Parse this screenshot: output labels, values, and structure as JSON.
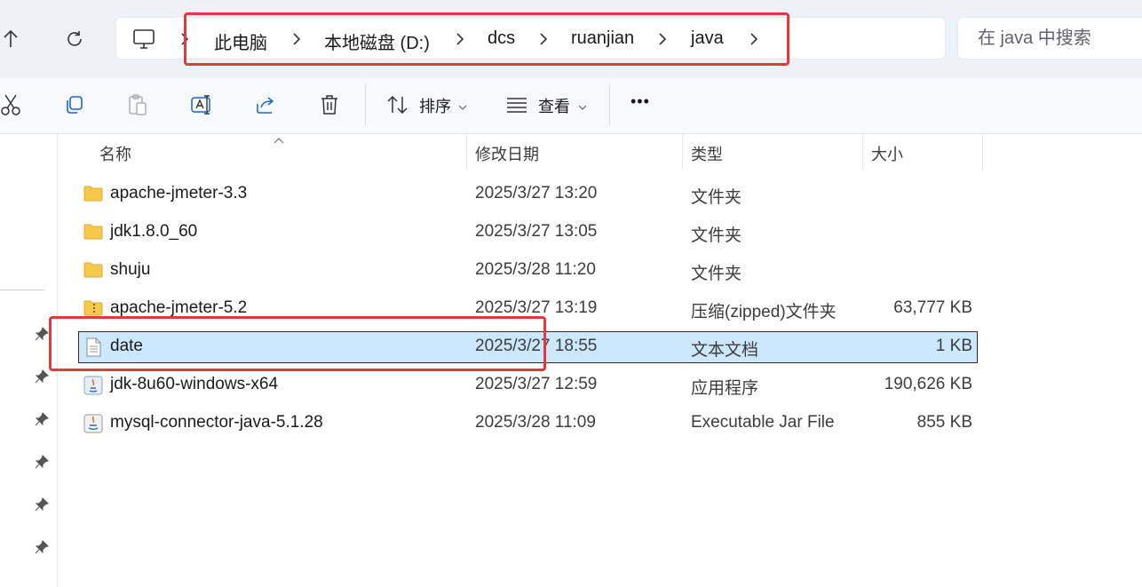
{
  "address_bar": {
    "crumbs": [
      "此电脑",
      "本地磁盘 (D:)",
      "dcs",
      "ruanjian",
      "java"
    ]
  },
  "search": {
    "placeholder": "在 java 中搜索"
  },
  "toolbar": {
    "sort_label": "排序",
    "view_label": "查看",
    "more_label": "•••"
  },
  "columns": {
    "name": "名称",
    "date": "修改日期",
    "type": "类型",
    "size": "大小"
  },
  "files": [
    {
      "name": "apache-jmeter-3.3",
      "date": "2025/3/27 13:20",
      "type": "文件夹",
      "size": "",
      "icon": "folder-icon"
    },
    {
      "name": "jdk1.8.0_60",
      "date": "2025/3/27 13:05",
      "type": "文件夹",
      "size": "",
      "icon": "folder-icon"
    },
    {
      "name": "shuju",
      "date": "2025/3/28 11:20",
      "type": "文件夹",
      "size": "",
      "icon": "folder-icon"
    },
    {
      "name": "apache-jmeter-5.2",
      "date": "2025/3/27 13:19",
      "type": "压缩(zipped)文件夹",
      "size": "63,777 KB",
      "icon": "zip-folder-icon"
    },
    {
      "name": "date",
      "date": "2025/3/27 18:55",
      "type": "文本文档",
      "size": "1 KB",
      "icon": "text-file-icon",
      "selected": true
    },
    {
      "name": "jdk-8u60-windows-x64",
      "date": "2025/3/27 12:59",
      "type": "应用程序",
      "size": "190,626 KB",
      "icon": "java-installer-icon"
    },
    {
      "name": "mysql-connector-java-5.1.28",
      "date": "2025/3/28 11:09",
      "type": "Executable Jar File",
      "size": "855 KB",
      "icon": "jar-file-icon"
    }
  ],
  "colors": {
    "highlight": "#e5383b",
    "selection": "#cce8ff",
    "folder": "#f7c94a"
  }
}
